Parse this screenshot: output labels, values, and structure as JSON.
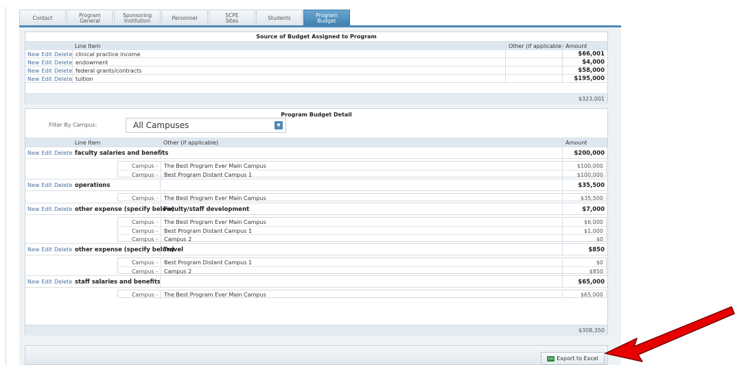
{
  "tabs": [
    {
      "line1": "Contact",
      "line2": ""
    },
    {
      "line1": "Program",
      "line2": "General"
    },
    {
      "line1": "Sponsoring",
      "line2": "Institution"
    },
    {
      "line1": "Personnel",
      "line2": ""
    },
    {
      "line1": "SCPE",
      "line2": "Sites"
    },
    {
      "line1": "Students",
      "line2": ""
    },
    {
      "line1": "Program",
      "line2": "Budget"
    }
  ],
  "links": {
    "new": "New",
    "edit": "Edit",
    "delete": "Delete"
  },
  "source": {
    "title": "Source of Budget Assigned to Program",
    "col_line": "Line Item",
    "col_other": "Other (if applicable)",
    "col_amount": "Amount",
    "rows": [
      {
        "item": "clinical practice income",
        "amount": "$66,001"
      },
      {
        "item": "endowment",
        "amount": "$4,000"
      },
      {
        "item": "federal grants/contracts",
        "amount": "$58,000"
      },
      {
        "item": "tuition",
        "amount": "$195,000"
      }
    ],
    "total": "$323,001"
  },
  "detail": {
    "title": "Program Budget Detail",
    "filter_label": "Filter By Campus:",
    "filter_value": "All Campuses",
    "col_line": "Line Item",
    "col_other": "Other (if applicable)",
    "col_amount": "Amount",
    "campus_label": "Campus -",
    "items": [
      {
        "item": "faculty salaries and benefits",
        "other": "",
        "amount": "$200,000",
        "campuses": [
          {
            "name": "The Best Program Ever Main Campus",
            "amount": "$100,000"
          },
          {
            "name": "Best Program Distant Campus 1",
            "amount": "$100,000"
          }
        ]
      },
      {
        "item": "operations",
        "other": "",
        "amount": "$35,500",
        "campuses": [
          {
            "name": "The Best Program Ever Main Campus",
            "amount": "$35,500"
          }
        ]
      },
      {
        "item": "other expense (specify below)",
        "other": "Faculty/staff development",
        "amount": "$7,000",
        "campuses": [
          {
            "name": "The Best Program Ever Main Campus",
            "amount": "$6,000"
          },
          {
            "name": "Best Program Distant Campus 1",
            "amount": "$1,000"
          },
          {
            "name": "Campus 2",
            "amount": "$0"
          }
        ]
      },
      {
        "item": "other expense (specify below)",
        "other": "Travel",
        "amount": "$850",
        "campuses": [
          {
            "name": "Best Program Distant Campus 1",
            "amount": "$0"
          },
          {
            "name": "Campus 2",
            "amount": "$850"
          }
        ]
      },
      {
        "item": "staff salaries and benefits",
        "other": "",
        "amount": "$65,000",
        "campuses": [
          {
            "name": "The Best Program Ever Main Campus",
            "amount": "$65,000"
          }
        ]
      }
    ],
    "total": "$308,350"
  },
  "export_label": "Export to Excel",
  "colors": {
    "tab_active": "#3d7fb0",
    "link": "#4a6fa5",
    "header_bg": "#dfe8f0",
    "arrow": "#e00000"
  }
}
